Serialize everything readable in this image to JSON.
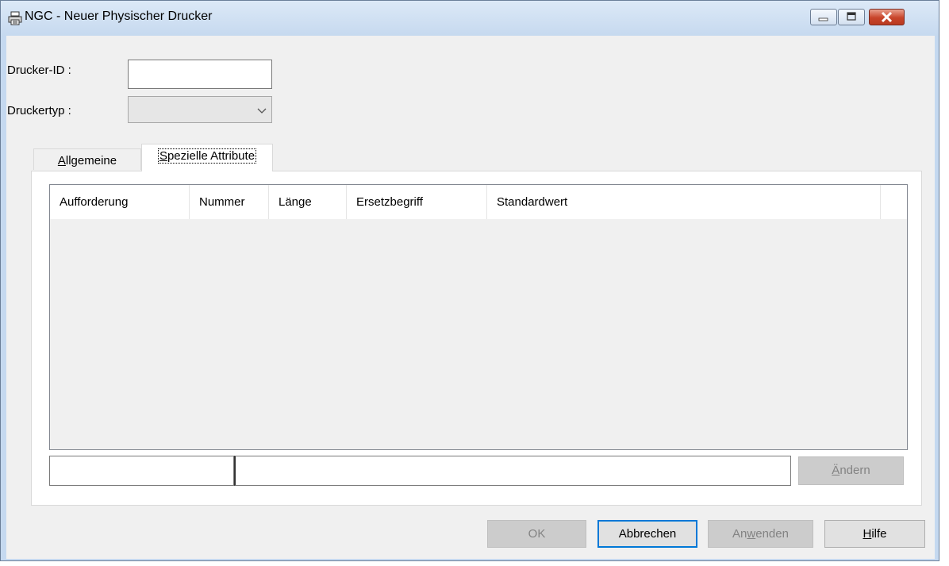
{
  "window": {
    "title": "NGC - Neuer Physischer Drucker"
  },
  "form": {
    "id_label": "Drucker-ID :",
    "id_value": "",
    "type_label": "Druckertyp :",
    "type_value": ""
  },
  "tabs": [
    {
      "label": "Allgemeine",
      "mnemonic": "A",
      "rest": "llgemeine",
      "active": false
    },
    {
      "label": "Spezielle Attribute",
      "mnemonic": "S",
      "rest": "pezielle Attribute",
      "active": true
    }
  ],
  "list": {
    "columns": [
      "Aufforderung",
      "Nummer",
      "Länge",
      "Ersetzbegriff",
      "Standardwert"
    ],
    "rows": []
  },
  "edit": {
    "field1_value": "",
    "field2_value": "",
    "change_button": {
      "pre": "",
      "mnemonic": "Ä",
      "post": "ndern",
      "label": "Ändern",
      "enabled": false
    }
  },
  "footer": {
    "ok": {
      "label": "OK",
      "enabled": false
    },
    "cancel": {
      "label": "Abbrechen",
      "enabled": true
    },
    "apply": {
      "pre": "An",
      "mnemonic": "w",
      "post": "enden",
      "label": "Anwenden",
      "enabled": false
    },
    "help": {
      "pre": "",
      "mnemonic": "H",
      "post": "ilfe",
      "label": "Hilfe",
      "enabled": true
    }
  },
  "colors": {
    "accent": "#0078d7",
    "close_button": "#c8442a",
    "frame": "#c5d9f0"
  },
  "icons": [
    "printer-icon",
    "minimize-icon",
    "maximize-icon",
    "close-icon",
    "chevron-down-icon"
  ]
}
